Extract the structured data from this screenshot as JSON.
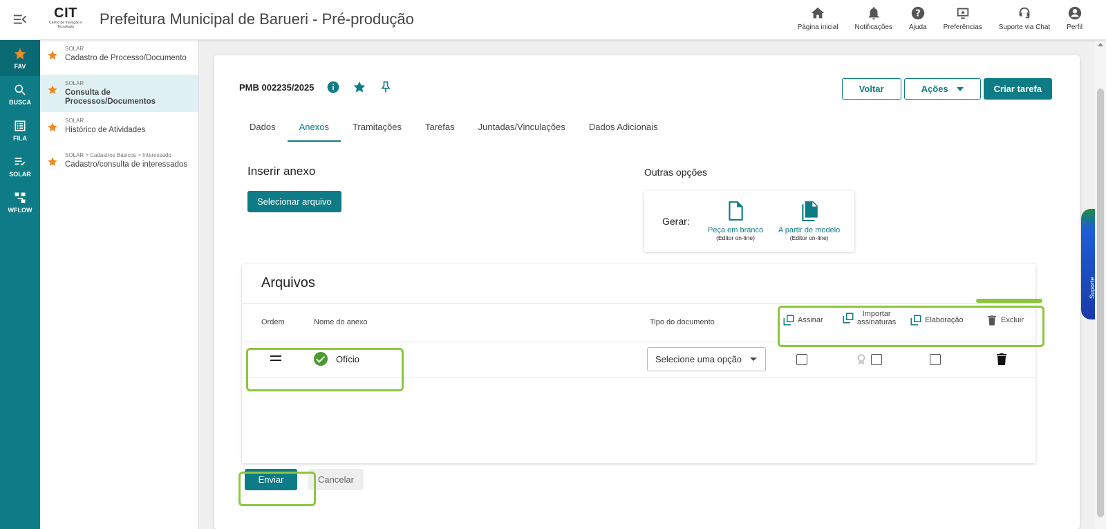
{
  "header": {
    "logo_main": "CIT",
    "logo_sub": "Centro de Inovação e Tecnologia",
    "title": "Prefeitura Municipal de Barueri - Pré-produção",
    "nav": [
      {
        "label": "Página inicial",
        "icon": "home-icon"
      },
      {
        "label": "Notificações",
        "icon": "bell-icon"
      },
      {
        "label": "Ajuda",
        "icon": "help-icon"
      },
      {
        "label": "Preferências",
        "icon": "preferences-icon"
      },
      {
        "label": "Suporte via Chat",
        "icon": "chat-support-icon"
      },
      {
        "label": "Perfil",
        "icon": "profile-icon"
      }
    ]
  },
  "rail": [
    {
      "label": "FAV",
      "icon": "star-icon"
    },
    {
      "label": "BUSCA",
      "icon": "search-icon"
    },
    {
      "label": "FILA",
      "icon": "list-icon"
    },
    {
      "label": "SOLAR",
      "icon": "checklist-icon"
    },
    {
      "label": "WFLOW",
      "icon": "workflow-icon"
    }
  ],
  "favorites": [
    {
      "crumb": "SOLAR",
      "label": "Cadastro de Processo/Documento"
    },
    {
      "crumb": "SOLAR",
      "label": "Consulta de Processos/Documentos"
    },
    {
      "crumb": "SOLAR",
      "label": "Histórico de Atividades"
    },
    {
      "crumb": "SOLAR > Cadastros Básicos > Interessado",
      "label": "Cadastro/consulta de interessados"
    }
  ],
  "support_tab": "Suporte",
  "process": {
    "id": "PMB 002235/2025",
    "icons": [
      "info-icon",
      "star-icon",
      "pin-icon"
    ]
  },
  "actions": {
    "back": "Voltar",
    "actions": "Ações",
    "create_task": "Criar tarefa"
  },
  "tabs": [
    "Dados",
    "Anexos",
    "Tramitações",
    "Tarefas",
    "Juntadas/Vinculações",
    "Dados Adicionais"
  ],
  "active_tab": "Anexos",
  "insert": {
    "title": "Inserir anexo",
    "button": "Selecionar arquivo"
  },
  "other": {
    "title": "Outras opções",
    "generate_label": "Gerar:",
    "options": [
      {
        "label": "Peça em branco",
        "sub": "(Editor on-line)",
        "icon": "blank-document-icon"
      },
      {
        "label": "A partir de modelo",
        "sub": "(Editor on-line)",
        "icon": "template-document-icon"
      }
    ]
  },
  "files": {
    "title": "Arquivos",
    "columns": {
      "order": "Ordem",
      "name": "Nome do anexo",
      "type": "Tipo do documento"
    },
    "header_actions": {
      "sign": "Assinar",
      "import_l1": "Importar",
      "import_l2": "assinaturas",
      "elaboration": "Elaboração",
      "delete": "Excluir"
    },
    "rows": [
      {
        "name": "Ofício",
        "type_placeholder": "Selecione uma opção",
        "sign": false,
        "import": false,
        "elaboration": false
      }
    ]
  },
  "footer": {
    "send": "Enviar",
    "cancel": "Cancelar"
  },
  "colors": {
    "primary": "#0e7c86",
    "highlight": "#8dc63f",
    "star": "#f08a24",
    "success": "#4a9a2e"
  }
}
